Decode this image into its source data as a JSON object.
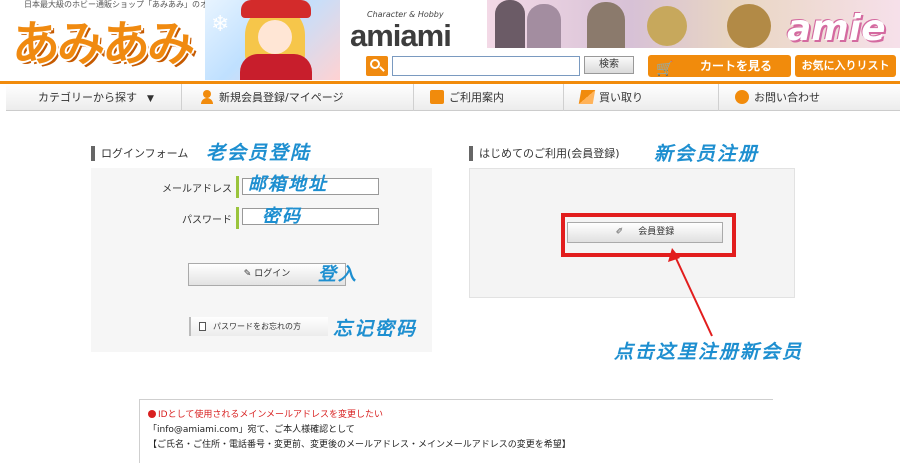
{
  "header": {
    "tagline": "日本最大級のホビー通販ショップ「あみあみ」のオンラインストア",
    "logo_text": "あみあみ",
    "brand_small": "Character & Hobby",
    "brand_big": "amiami",
    "banner_text": "amie",
    "search": {
      "placeholder": "",
      "button_label": "検索"
    },
    "cart_label": "カートを見る",
    "favorites_label": "お気に入りリスト"
  },
  "nav": {
    "items": [
      {
        "label": "カテゴリーから探す"
      },
      {
        "label": "新規会員登録/マイページ"
      },
      {
        "label": "ご利用案内"
      },
      {
        "label": "買い取り"
      },
      {
        "label": "お問い合わせ"
      }
    ]
  },
  "login": {
    "title": "ログインフォーム",
    "annotation": "老会员登陆",
    "email_label": "メールアドレス",
    "email_annotation": "邮箱地址",
    "password_label": "パスワード",
    "password_annotation": "密码",
    "login_button": "ログイン",
    "login_annotation": "登入",
    "forgot_button": "パスワードをお忘れの方",
    "forgot_annotation": "忘记密码"
  },
  "register": {
    "title": "はじめてのご利用(会員登録)",
    "annotation": "新会员注册",
    "button_label": "会員登録",
    "arrow_annotation": "点击这里注册新会员"
  },
  "notice": {
    "line1": "IDとして使用されるメインメールアドレスを変更したい",
    "line2": "「info@amiami.com」宛て、ご本人様確認として",
    "line3": "【ご氏名・ご住所・電話番号・変更前、変更後のメールアドレス・メインメールアドレスの変更を希望】"
  },
  "colors": {
    "brand_orange": "#f18b0c",
    "annotation_blue": "#1e8fd0",
    "highlight_red": "#e21d1d",
    "field_accent_green": "#9ac43c"
  }
}
